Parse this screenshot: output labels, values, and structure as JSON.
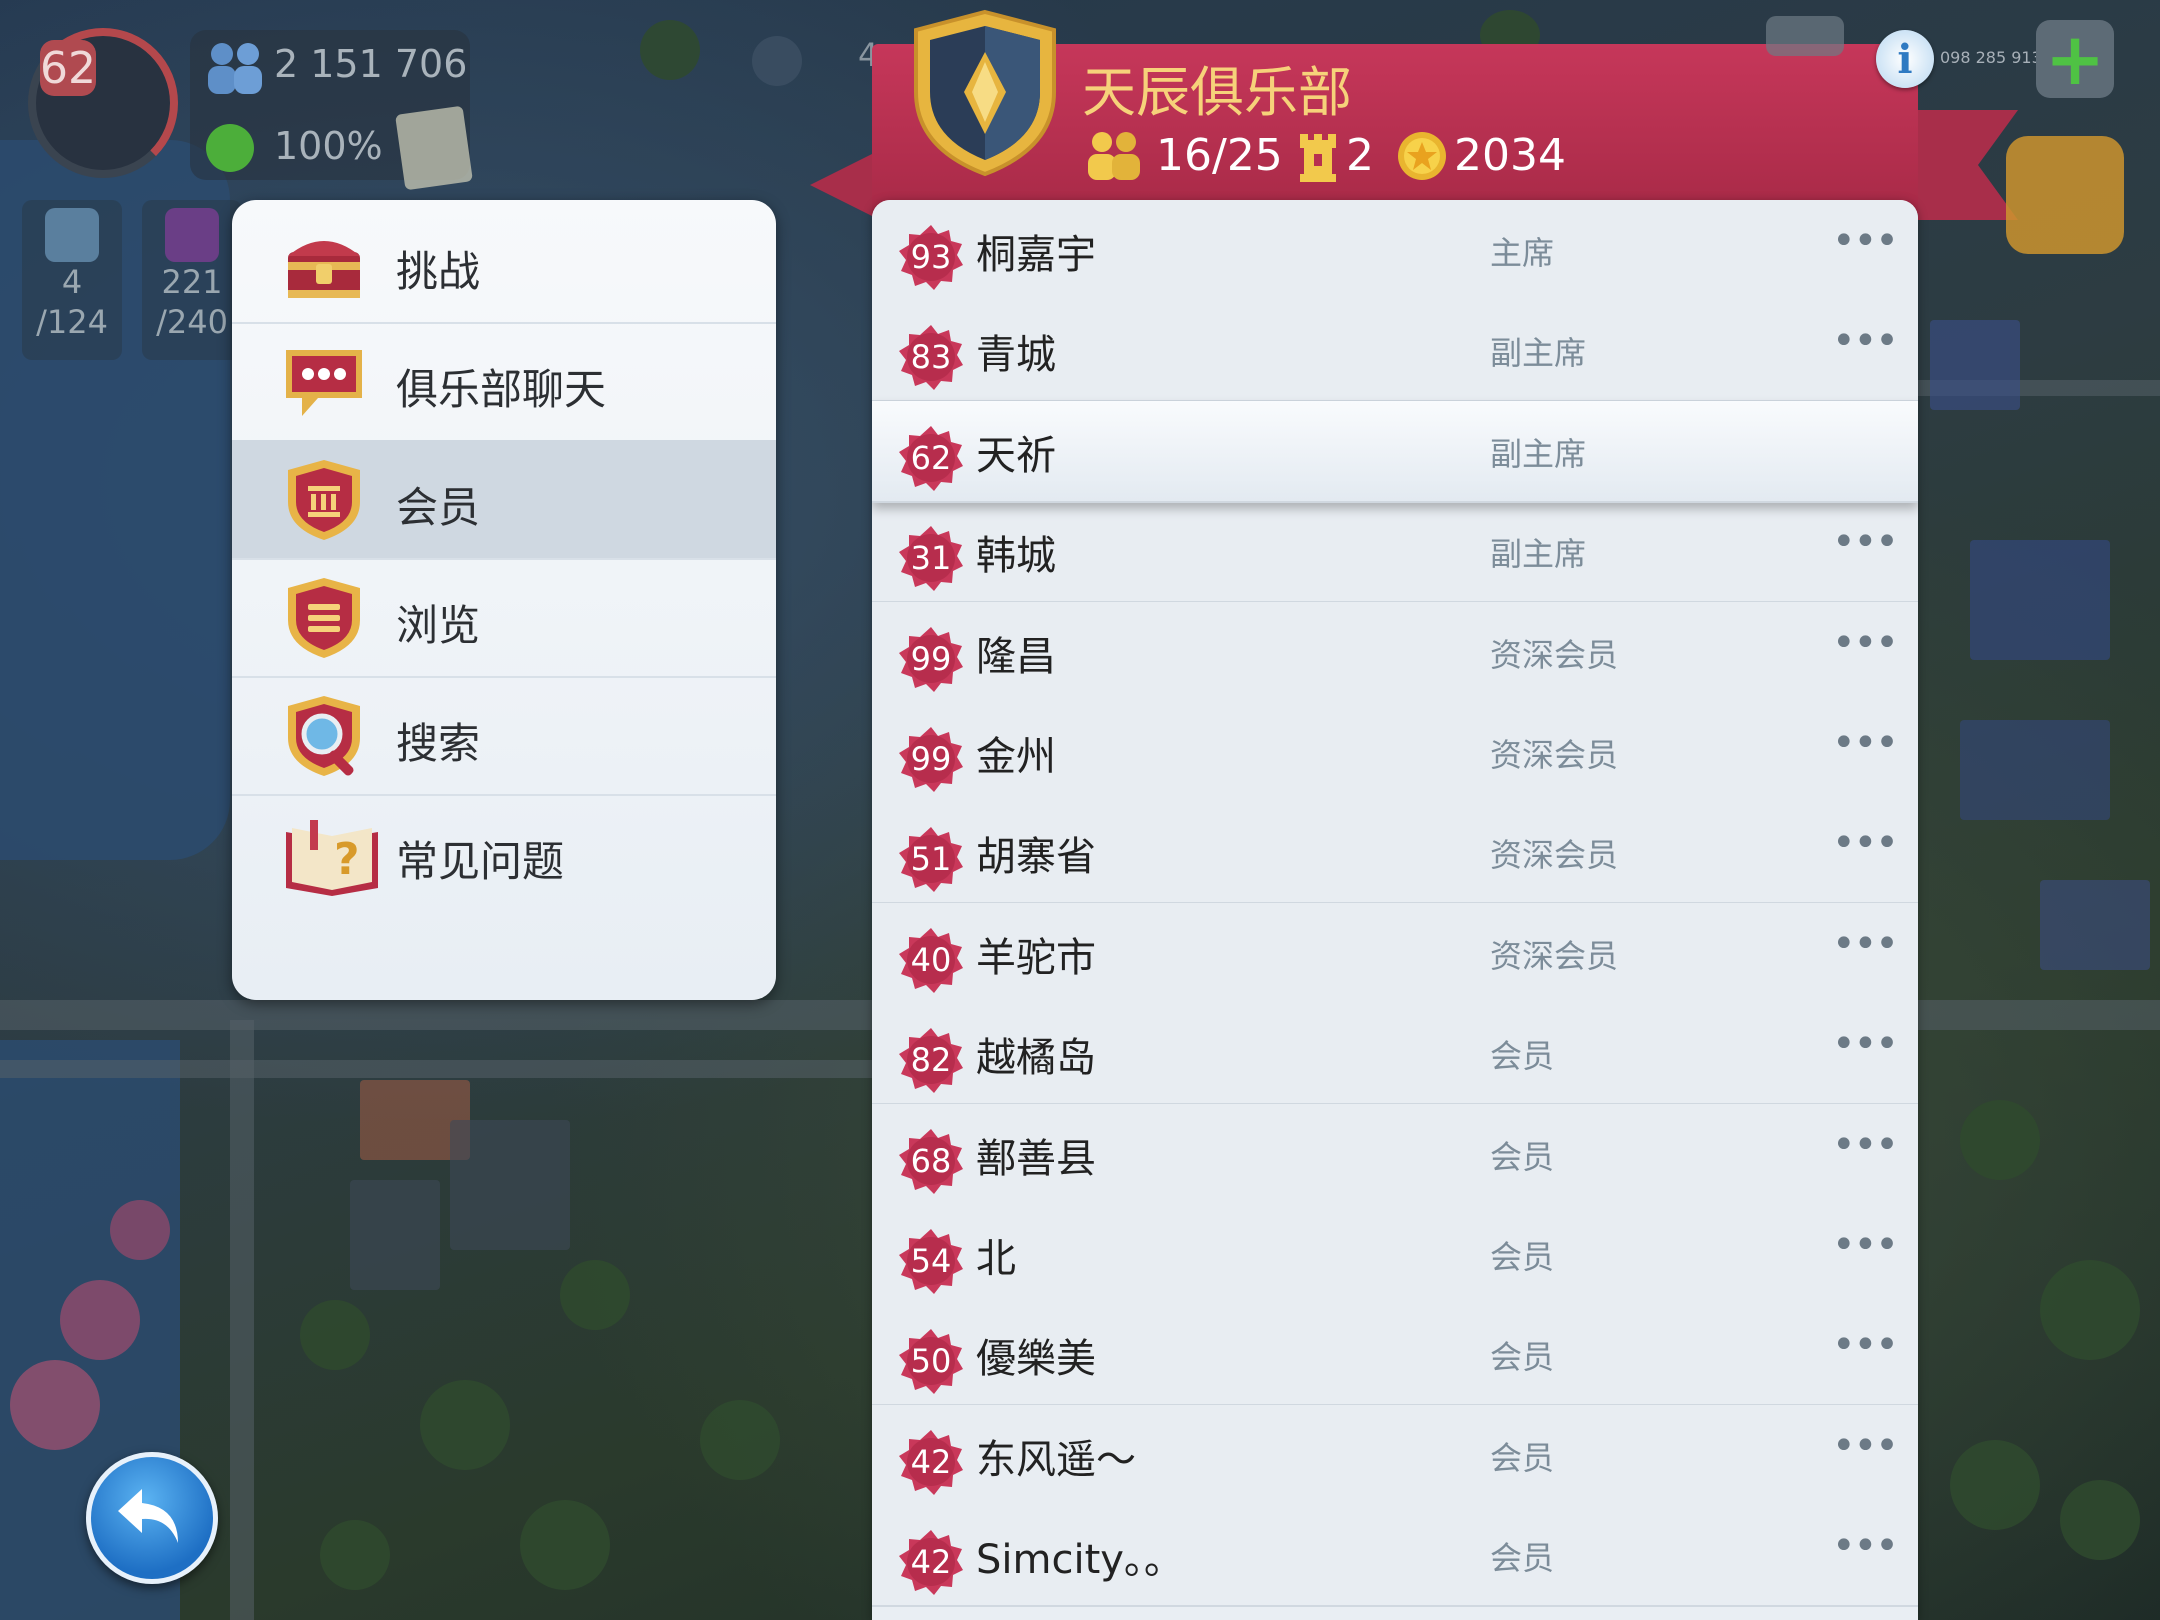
{
  "hud": {
    "level": "62",
    "population": "2 151 706",
    "happiness": "100%",
    "storage": [
      {
        "value": "4",
        "capacity": "/124",
        "icon": "water-tower-icon"
      },
      {
        "value": "221",
        "capacity": "/240",
        "icon": "warehouse-icon"
      }
    ],
    "top_partial_number": "4",
    "money": "098 285 913"
  },
  "menu": {
    "items": [
      {
        "label": "挑战",
        "icon": "treasure-chest-icon"
      },
      {
        "label": "俱乐部聊天",
        "icon": "chat-bubble-icon"
      },
      {
        "label": "会员",
        "icon": "members-shield-icon",
        "active": true
      },
      {
        "label": "浏览",
        "icon": "browse-shield-icon"
      },
      {
        "label": "搜索",
        "icon": "search-magnifier-icon"
      },
      {
        "label": "常见问题",
        "icon": "faq-book-icon"
      }
    ]
  },
  "club": {
    "name": "天辰俱乐部",
    "members_count": "16/25",
    "wars_count": "2",
    "points": "2034",
    "members": [
      {
        "level": "93",
        "name": "桐嘉宇",
        "role": "主席"
      },
      {
        "level": "83",
        "name": "青城",
        "role": "副主席"
      },
      {
        "level": "62",
        "name": "天祈",
        "role": "副主席",
        "highlighted": true
      },
      {
        "level": "31",
        "name": "韩城",
        "role": "副主席"
      },
      {
        "level": "99",
        "name": "隆昌",
        "role": "资深会员"
      },
      {
        "level": "99",
        "name": "金州",
        "role": "资深会员"
      },
      {
        "level": "51",
        "name": "胡寨省",
        "role": "资深会员"
      },
      {
        "level": "40",
        "name": "羊驼市",
        "role": "资深会员"
      },
      {
        "level": "82",
        "name": "越橘岛",
        "role": "会员"
      },
      {
        "level": "68",
        "name": "鄯善县",
        "role": "会员"
      },
      {
        "level": "54",
        "name": "北",
        "role": "会员"
      },
      {
        "level": "50",
        "name": "優樂美",
        "role": "会员"
      },
      {
        "level": "42",
        "name": "东风遥～",
        "role": "会员"
      },
      {
        "level": "42",
        "name": "Simcity。。",
        "role": "会员"
      }
    ],
    "more_label": "•••"
  },
  "colors": {
    "header": "#b8304f",
    "club_name": "#f6d27a",
    "level_badge": "#c9385a",
    "role_text": "#7c8c99"
  }
}
